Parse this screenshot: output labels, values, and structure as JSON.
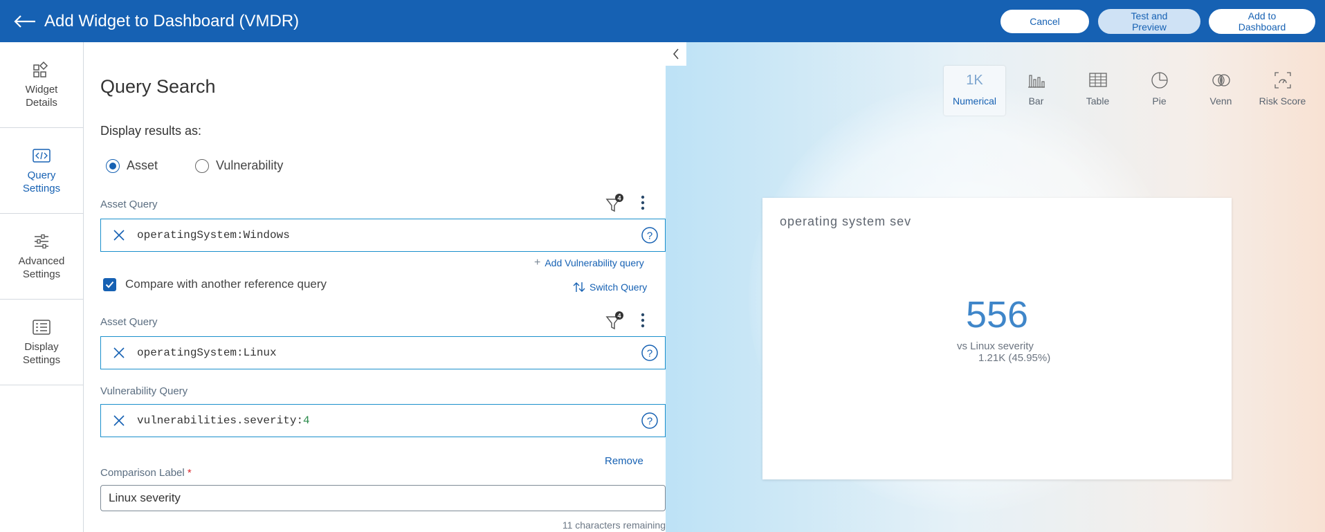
{
  "header": {
    "title": "Add Widget to Dashboard (VMDR)",
    "cancel_label": "Cancel",
    "test_label": "Test and Preview",
    "add_label": "Add to Dashboard"
  },
  "sidebar": {
    "items": [
      {
        "label": "Widget\nDetails",
        "icon": "widget-details-icon"
      },
      {
        "label": "Query\nSettings",
        "icon": "code-icon",
        "active": true
      },
      {
        "label": "Advanced\nSettings",
        "icon": "sliders-icon"
      },
      {
        "label": "Display\nSettings",
        "icon": "display-list-icon"
      }
    ]
  },
  "form": {
    "title": "Query Search",
    "display_as_label": "Display results as:",
    "radio_asset": "Asset",
    "radio_vuln": "Vulnerability",
    "selected": "Asset",
    "asset_query_label": "Asset Query",
    "filter_count": "4",
    "query1": "operatingSystem:Windows",
    "add_vuln_link": "Add Vulnerability query",
    "compare_label": "Compare with another reference query",
    "switch_query": "Switch Query",
    "asset_query2_label": "Asset Query",
    "filter_count2": "4",
    "query2": "operatingSystem:Linux",
    "vuln_query_label": "Vulnerability Query",
    "query3_key": "vulnerabilities.severity:",
    "query3_value": "4",
    "remove_link": "Remove",
    "comparison_label": "Comparison Label",
    "required_mark": "*",
    "comparison_value": "Linux severity",
    "chars_remaining": "11 characters remaining"
  },
  "preview": {
    "types": [
      {
        "label": "Numerical",
        "icon": "numerical-icon",
        "glyph": "1K",
        "active": true
      },
      {
        "label": "Bar",
        "icon": "bar-chart-icon"
      },
      {
        "label": "Table",
        "icon": "table-icon"
      },
      {
        "label": "Pie",
        "icon": "pie-chart-icon"
      },
      {
        "label": "Venn",
        "icon": "venn-icon"
      },
      {
        "label": "Risk Score",
        "icon": "risk-score-icon"
      }
    ],
    "widget": {
      "title": "operating system sev",
      "value": "556",
      "compare_text": "vs Linux severity",
      "compare_value": "1.21K (45.95%)"
    }
  },
  "colors": {
    "brand": "#1661b3",
    "border_accent": "#1a8fcc",
    "required": "#d9262b"
  }
}
